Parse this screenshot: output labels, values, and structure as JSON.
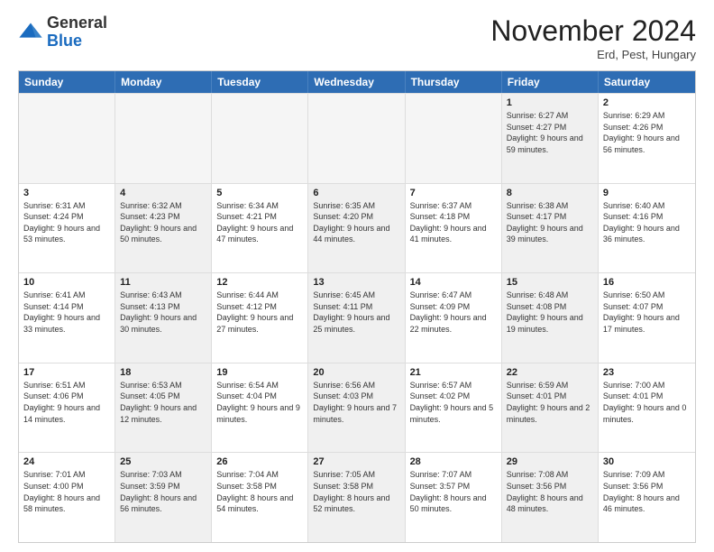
{
  "logo": {
    "general": "General",
    "blue": "Blue"
  },
  "title": "November 2024",
  "location": "Erd, Pest, Hungary",
  "header_days": [
    "Sunday",
    "Monday",
    "Tuesday",
    "Wednesday",
    "Thursday",
    "Friday",
    "Saturday"
  ],
  "rows": [
    [
      {
        "day": "",
        "info": "",
        "empty": true
      },
      {
        "day": "",
        "info": "",
        "empty": true
      },
      {
        "day": "",
        "info": "",
        "empty": true
      },
      {
        "day": "",
        "info": "",
        "empty": true
      },
      {
        "day": "",
        "info": "",
        "empty": true
      },
      {
        "day": "1",
        "info": "Sunrise: 6:27 AM\nSunset: 4:27 PM\nDaylight: 9 hours and 59 minutes.",
        "shaded": true
      },
      {
        "day": "2",
        "info": "Sunrise: 6:29 AM\nSunset: 4:26 PM\nDaylight: 9 hours and 56 minutes.",
        "shaded": false
      }
    ],
    [
      {
        "day": "3",
        "info": "Sunrise: 6:31 AM\nSunset: 4:24 PM\nDaylight: 9 hours and 53 minutes.",
        "shaded": false
      },
      {
        "day": "4",
        "info": "Sunrise: 6:32 AM\nSunset: 4:23 PM\nDaylight: 9 hours and 50 minutes.",
        "shaded": true
      },
      {
        "day": "5",
        "info": "Sunrise: 6:34 AM\nSunset: 4:21 PM\nDaylight: 9 hours and 47 minutes.",
        "shaded": false
      },
      {
        "day": "6",
        "info": "Sunrise: 6:35 AM\nSunset: 4:20 PM\nDaylight: 9 hours and 44 minutes.",
        "shaded": true
      },
      {
        "day": "7",
        "info": "Sunrise: 6:37 AM\nSunset: 4:18 PM\nDaylight: 9 hours and 41 minutes.",
        "shaded": false
      },
      {
        "day": "8",
        "info": "Sunrise: 6:38 AM\nSunset: 4:17 PM\nDaylight: 9 hours and 39 minutes.",
        "shaded": true
      },
      {
        "day": "9",
        "info": "Sunrise: 6:40 AM\nSunset: 4:16 PM\nDaylight: 9 hours and 36 minutes.",
        "shaded": false
      }
    ],
    [
      {
        "day": "10",
        "info": "Sunrise: 6:41 AM\nSunset: 4:14 PM\nDaylight: 9 hours and 33 minutes.",
        "shaded": false
      },
      {
        "day": "11",
        "info": "Sunrise: 6:43 AM\nSunset: 4:13 PM\nDaylight: 9 hours and 30 minutes.",
        "shaded": true
      },
      {
        "day": "12",
        "info": "Sunrise: 6:44 AM\nSunset: 4:12 PM\nDaylight: 9 hours and 27 minutes.",
        "shaded": false
      },
      {
        "day": "13",
        "info": "Sunrise: 6:45 AM\nSunset: 4:11 PM\nDaylight: 9 hours and 25 minutes.",
        "shaded": true
      },
      {
        "day": "14",
        "info": "Sunrise: 6:47 AM\nSunset: 4:09 PM\nDaylight: 9 hours and 22 minutes.",
        "shaded": false
      },
      {
        "day": "15",
        "info": "Sunrise: 6:48 AM\nSunset: 4:08 PM\nDaylight: 9 hours and 19 minutes.",
        "shaded": true
      },
      {
        "day": "16",
        "info": "Sunrise: 6:50 AM\nSunset: 4:07 PM\nDaylight: 9 hours and 17 minutes.",
        "shaded": false
      }
    ],
    [
      {
        "day": "17",
        "info": "Sunrise: 6:51 AM\nSunset: 4:06 PM\nDaylight: 9 hours and 14 minutes.",
        "shaded": false
      },
      {
        "day": "18",
        "info": "Sunrise: 6:53 AM\nSunset: 4:05 PM\nDaylight: 9 hours and 12 minutes.",
        "shaded": true
      },
      {
        "day": "19",
        "info": "Sunrise: 6:54 AM\nSunset: 4:04 PM\nDaylight: 9 hours and 9 minutes.",
        "shaded": false
      },
      {
        "day": "20",
        "info": "Sunrise: 6:56 AM\nSunset: 4:03 PM\nDaylight: 9 hours and 7 minutes.",
        "shaded": true
      },
      {
        "day": "21",
        "info": "Sunrise: 6:57 AM\nSunset: 4:02 PM\nDaylight: 9 hours and 5 minutes.",
        "shaded": false
      },
      {
        "day": "22",
        "info": "Sunrise: 6:59 AM\nSunset: 4:01 PM\nDaylight: 9 hours and 2 minutes.",
        "shaded": true
      },
      {
        "day": "23",
        "info": "Sunrise: 7:00 AM\nSunset: 4:01 PM\nDaylight: 9 hours and 0 minutes.",
        "shaded": false
      }
    ],
    [
      {
        "day": "24",
        "info": "Sunrise: 7:01 AM\nSunset: 4:00 PM\nDaylight: 8 hours and 58 minutes.",
        "shaded": false
      },
      {
        "day": "25",
        "info": "Sunrise: 7:03 AM\nSunset: 3:59 PM\nDaylight: 8 hours and 56 minutes.",
        "shaded": true
      },
      {
        "day": "26",
        "info": "Sunrise: 7:04 AM\nSunset: 3:58 PM\nDaylight: 8 hours and 54 minutes.",
        "shaded": false
      },
      {
        "day": "27",
        "info": "Sunrise: 7:05 AM\nSunset: 3:58 PM\nDaylight: 8 hours and 52 minutes.",
        "shaded": true
      },
      {
        "day": "28",
        "info": "Sunrise: 7:07 AM\nSunset: 3:57 PM\nDaylight: 8 hours and 50 minutes.",
        "shaded": false
      },
      {
        "day": "29",
        "info": "Sunrise: 7:08 AM\nSunset: 3:56 PM\nDaylight: 8 hours and 48 minutes.",
        "shaded": true
      },
      {
        "day": "30",
        "info": "Sunrise: 7:09 AM\nSunset: 3:56 PM\nDaylight: 8 hours and 46 minutes.",
        "shaded": false
      }
    ]
  ]
}
